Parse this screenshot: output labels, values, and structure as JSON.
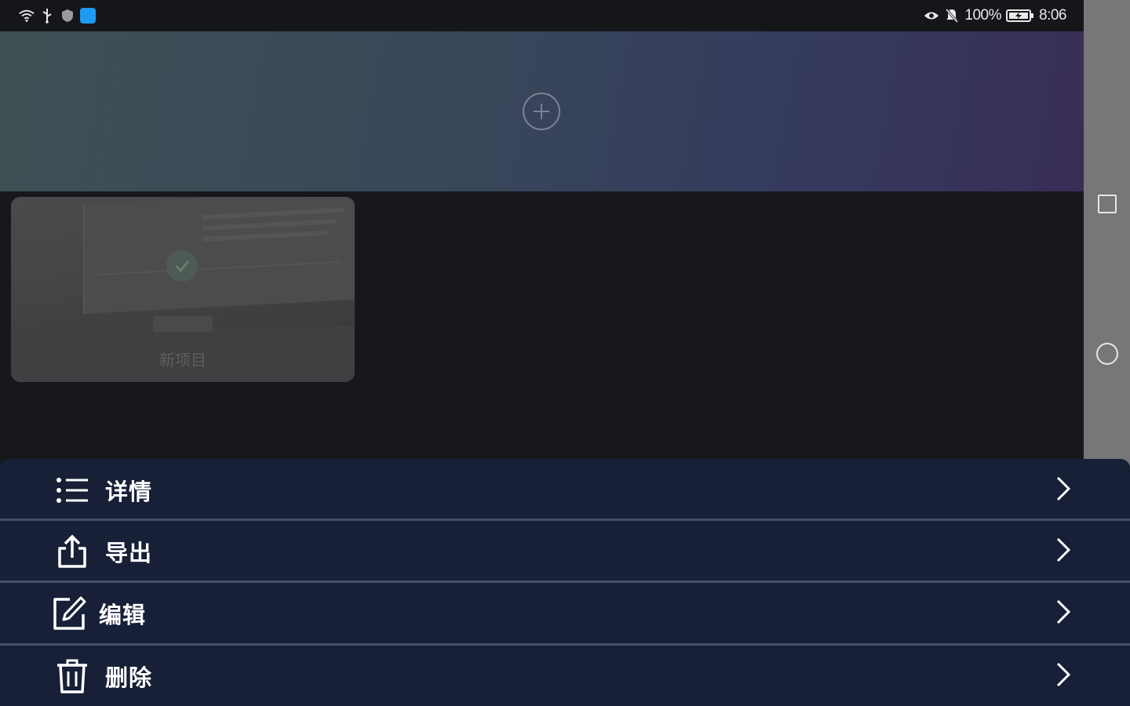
{
  "status_bar": {
    "battery_text": "100%",
    "time": "8:06",
    "icons": [
      "wifi-icon",
      "usb-icon",
      "shield-icon",
      "app-notification-icon",
      "eye-icon",
      "mute-bell-icon",
      "battery-icon"
    ]
  },
  "banner": {
    "add_icon": "add-circle-icon"
  },
  "project_card": {
    "title": "新项目",
    "selected": true
  },
  "menu": {
    "items": [
      {
        "label": "详情",
        "icon": "list-icon"
      },
      {
        "label": "导出",
        "icon": "share-icon"
      },
      {
        "label": "编辑",
        "icon": "edit-icon"
      },
      {
        "label": "删除",
        "icon": "trash-icon"
      }
    ]
  },
  "nav_bar": {
    "icons": [
      "recent-apps-icon",
      "home-icon",
      "back-icon"
    ]
  },
  "colors": {
    "sheet_bg": "#172036",
    "page_bg": "#17181c",
    "nav_bg": "#777777"
  }
}
